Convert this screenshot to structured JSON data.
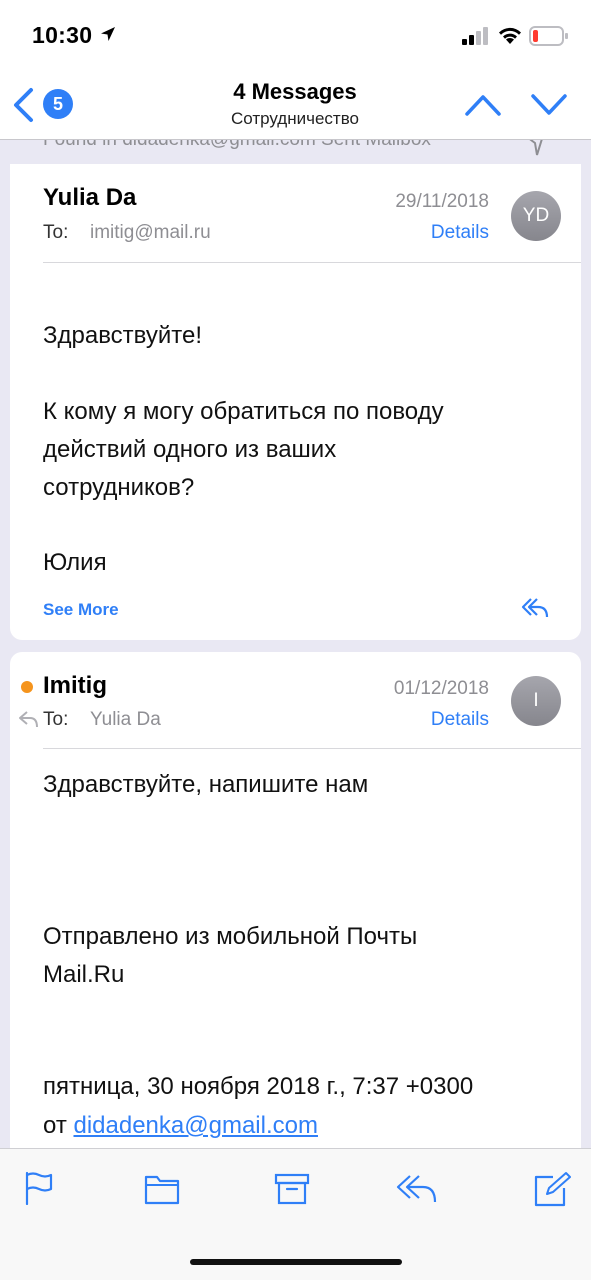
{
  "status_bar": {
    "time": "10:30",
    "icons": [
      "location-arrow-icon",
      "cellular-signal-icon",
      "wifi-icon",
      "battery-low-icon"
    ],
    "battery_color": "#ff3b30"
  },
  "nav": {
    "back_count": "5",
    "title": "4 Messages",
    "subtitle": "Сотрудничество",
    "icons": [
      "chevron-left-icon",
      "chevron-up-icon",
      "chevron-down-icon"
    ]
  },
  "found_banner": {
    "text": "Found in didadenka@gmail.com Sent Mailbox"
  },
  "messages": [
    {
      "sender": "Yulia Da",
      "to_label": "To:",
      "to": "imitig@mail.ru",
      "date": "29/11/2018",
      "details": "Details",
      "avatar": "YD",
      "body": [
        "Здравствуйте!",
        "К кому я могу обратиться по поводу",
        "действий одного из ваших",
        "сотрудников?",
        "Юлия"
      ],
      "see_more": "See More"
    },
    {
      "sender": "Imitig",
      "unread": true,
      "replied": true,
      "to_label": "To:",
      "to": "Yulia Da",
      "date": "01/12/2018",
      "details": "Details",
      "avatar": "I",
      "body": [
        "Здравствуйте, напишите нам",
        "Отправлено из мобильной Почты",
        "Mail.Ru",
        "пятница, 30 ноября 2018 г., 7:37 +0300"
      ],
      "body_from_prefix": "от",
      "body_from_link": "didadenka@gmail.com"
    }
  ],
  "toolbar": {
    "items": [
      "flag-icon",
      "folder-icon",
      "archive-icon",
      "reply-icon",
      "compose-icon"
    ]
  },
  "colors": {
    "accent": "#2f7ff7",
    "unread_dot": "#f5941d",
    "secondary_text": "#8e8e93",
    "background": "#e9e8f3"
  }
}
